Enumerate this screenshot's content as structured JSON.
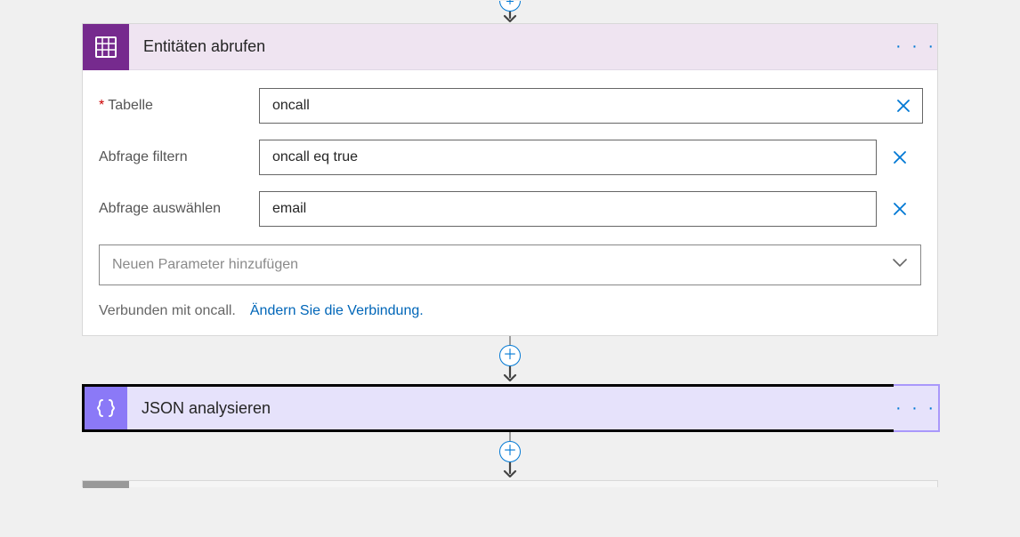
{
  "entities_card": {
    "title": "Entitäten abrufen",
    "icon": "table-grid-icon",
    "fields": {
      "table_label": "Tabelle",
      "table_value": "oncall",
      "filter_label": "Abfrage filtern",
      "filter_value": "oncall eq true",
      "select_label": "Abfrage auswählen",
      "select_value": "email"
    },
    "add_parameter_placeholder": "Neuen Parameter hinzufügen",
    "connection_text": "Verbunden mit oncall.",
    "connection_link": "Ändern Sie die Verbindung."
  },
  "json_card": {
    "title": "JSON analysieren",
    "icon": "json-braces-icon"
  }
}
